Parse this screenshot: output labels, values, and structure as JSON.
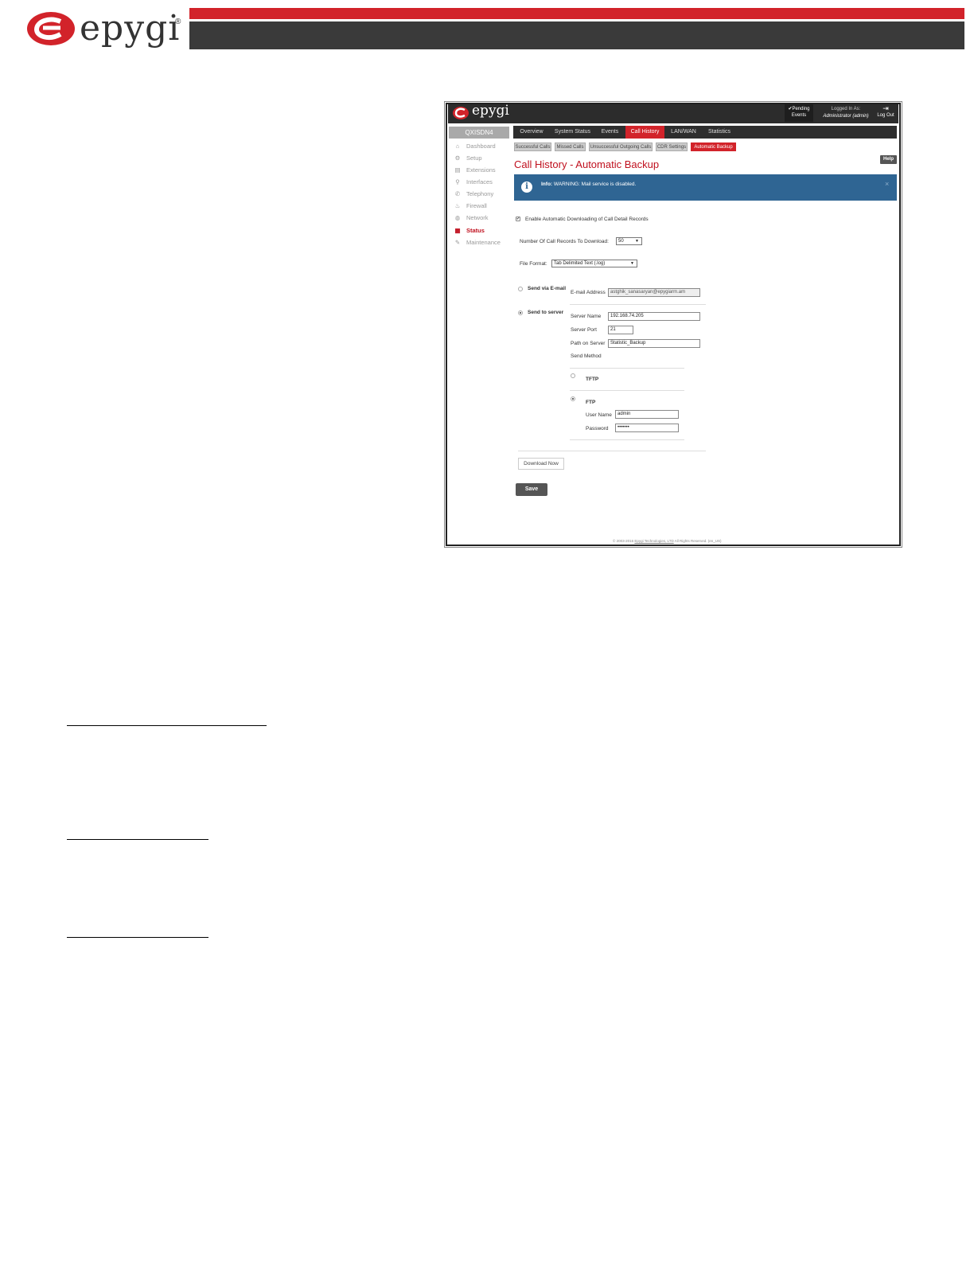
{
  "page_header": {
    "brand": "epygi",
    "reg": "®"
  },
  "app": {
    "brand": "epygi",
    "pending": [
      "✔Pending",
      "Events"
    ],
    "logged_label": "Logged In As:",
    "logged_user": "Administrator (admin)",
    "logout_label": "Log Out",
    "device": "QXISDN4"
  },
  "sidebar": [
    {
      "label": "Dashboard",
      "icon": "⌂"
    },
    {
      "label": "Setup",
      "icon": "⚙"
    },
    {
      "label": "Extensions",
      "icon": "▤"
    },
    {
      "label": "Interfaces",
      "icon": "⚲"
    },
    {
      "label": "Telephony",
      "icon": "✆"
    },
    {
      "label": "Firewall",
      "icon": "♨"
    },
    {
      "label": "Network",
      "icon": "◍"
    },
    {
      "label": "Status",
      "icon": "▦"
    },
    {
      "label": "Maintenance",
      "icon": "✎"
    }
  ],
  "tabs": [
    "Overview",
    "System Status",
    "Events",
    "Call History",
    "LAN/WAN",
    "Statistics"
  ],
  "subtabs": [
    "Successful Calls",
    "Missed Calls",
    "Unsuccessful Outgoing Calls",
    "CDR Settings",
    "Automatic Backup"
  ],
  "page_title": "Call History - Automatic Backup",
  "help": "Help",
  "info": {
    "prefix": "Info:",
    "message": "WARNING: Mail service is disabled.",
    "close": "×"
  },
  "form": {
    "enable_label": "Enable Automatic Downloading of Call Detail Records",
    "records_label": "Number Of Call Records To Download:",
    "records_value": "50",
    "format_label": "File Format:",
    "format_value": "Tab Delimited Text (.log)",
    "email_option": "Send via E-mail",
    "email_label": "E-mail Address",
    "email_value": "astghik_sanasaryan@epygiarm.am",
    "server_option": "Send to server",
    "server_name_label": "Server Name",
    "server_name_value": "192.168.74.205",
    "server_port_label": "Server Port",
    "server_port_value": "21",
    "path_label": "Path on Server",
    "path_value": "Statistic_Backup",
    "method_label": "Send Method",
    "tftp": "TFTP",
    "ftp": "FTP",
    "user_label": "User Name",
    "user_value": "admin",
    "pass_label": "Password",
    "pass_value": "•••••••"
  },
  "buttons": {
    "download": "Download Now",
    "save": "Save"
  },
  "footer": {
    "prefix": "© 2003-2016 ",
    "company": "Epygi Technologies, LTD",
    "suffix": " All Rights Reserved. (en_US)"
  }
}
